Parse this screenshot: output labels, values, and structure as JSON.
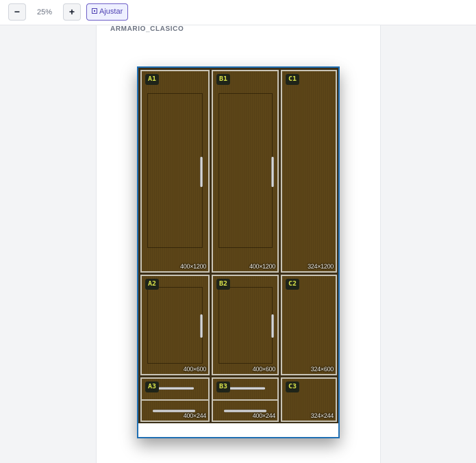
{
  "toolbar": {
    "zoom_out_label": "−",
    "zoom_level": "25%",
    "zoom_in_label": "+",
    "fit_label": "Ajustar",
    "fit_icon": "fit-icon"
  },
  "sheet": {
    "title": "ARMARIO_CLASICO"
  },
  "colors": {
    "cabinet_outline": "#1f6fb3",
    "panel_wood": "#5c4518",
    "panel_border": "#c9c4b6",
    "tag_bg": "#1f2419",
    "tag_text": "#d8e24a",
    "fit_button_accent": "#4c3fb1"
  },
  "panels": {
    "A1": {
      "label": "A1",
      "dims": "400×1200"
    },
    "B1": {
      "label": "B1",
      "dims": "400×1200"
    },
    "C1": {
      "label": "C1",
      "dims": "324×1200"
    },
    "A2": {
      "label": "A2",
      "dims": "400×600"
    },
    "B2": {
      "label": "B2",
      "dims": "400×600"
    },
    "C2": {
      "label": "C2",
      "dims": "324×600"
    },
    "A3": {
      "label": "A3",
      "dims": "400×244"
    },
    "B3": {
      "label": "B3",
      "dims": "400×244"
    },
    "C3": {
      "label": "C3",
      "dims": "324×244"
    }
  }
}
